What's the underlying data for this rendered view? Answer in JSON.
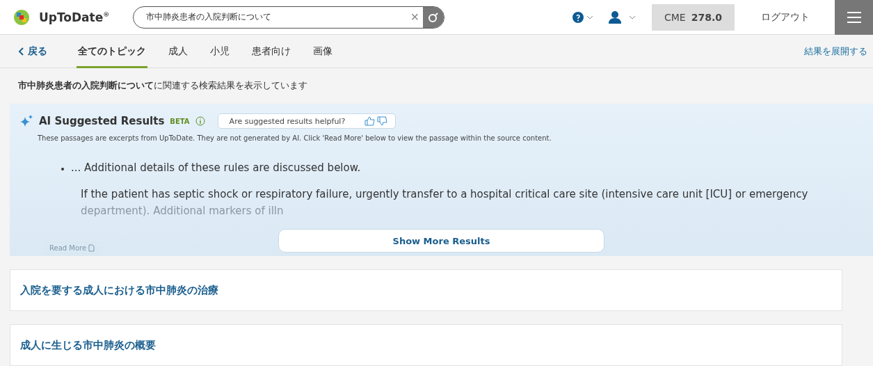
{
  "header": {
    "brand": "UpToDate",
    "brand_mark": "®",
    "search": {
      "value": "市中肺炎患者の入院判断について",
      "clear": "×"
    },
    "cme": {
      "label": "CME",
      "value": "278.0"
    },
    "logout": "ログアウト"
  },
  "nav": {
    "back": "戻る",
    "tabs": [
      {
        "label": "全てのトピック",
        "selected": true
      },
      {
        "label": "成人",
        "selected": false
      },
      {
        "label": "小児",
        "selected": false
      },
      {
        "label": "患者向け",
        "selected": false
      },
      {
        "label": "画像",
        "selected": false
      }
    ],
    "expand": "結果を展開する"
  },
  "query_line": "**市中肺炎患者の入院判断について**に関連する検索結果を表示しています",
  "ai": {
    "title": "AI Suggested Results",
    "badge": "BETA",
    "feedback": "Are suggested results helpful?",
    "note": "These passages are excerpts from UpToDate. They are not generated by AI. Click 'Read More' below to view the passage within the source content.",
    "bullet": "... Additional details of these rules are discussed below.",
    "paragraph": "If the patient has septic shock or respiratory failure, urgently transfer to a hospital critical care site (intensive care unit [ICU] or emergency",
    "faded_line": "department). Additional markers of illn",
    "read_more": "Read More",
    "show_more": "Show More Results"
  },
  "results": [
    {
      "title": "入院を要する成人における市中肺炎の治療"
    },
    {
      "title": "成人に生じる市中肺炎の概要"
    }
  ]
}
